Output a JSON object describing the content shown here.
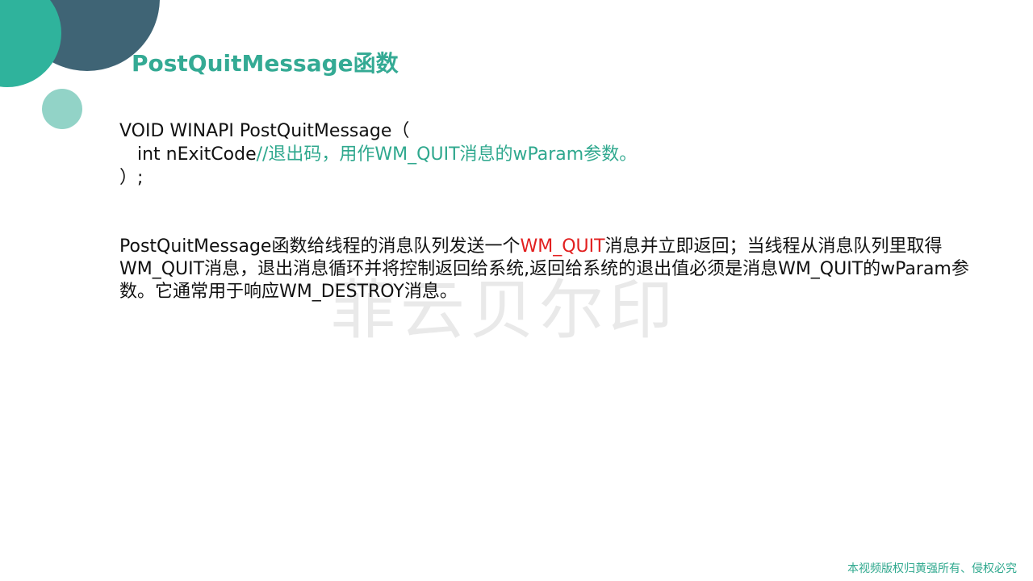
{
  "title": "PostQuitMessage函数",
  "watermark": "菲云贝尔印",
  "code": {
    "line1": "VOID WINAPI PostQuitMessage（",
    "line2_code": "int nExitCode",
    "line2_comment": "//退出码，用作WM_QUIT消息的wParam参数。",
    "line3": "）;"
  },
  "paragraph": {
    "part1": "PostQuitMessage函数给线程的消息队列发送一个",
    "highlight": "WM_QUIT",
    "part2": "消息并立即返回；当线程从消息队列里取得WM_QUIT消息，退出消息循环并将控制返回给系统,返回给系统的退出值必须是消息WM_QUIT的wParam参数。它通常用于响应WM_DESTROY消息。"
  },
  "footer": "本视频版权归黄强所有、侵权必究",
  "colors": {
    "accent_teal": "#2fb39c",
    "accent_dark": "#3f6475",
    "accent_light": "#92d3c7",
    "highlight_red": "#e21f1f"
  }
}
